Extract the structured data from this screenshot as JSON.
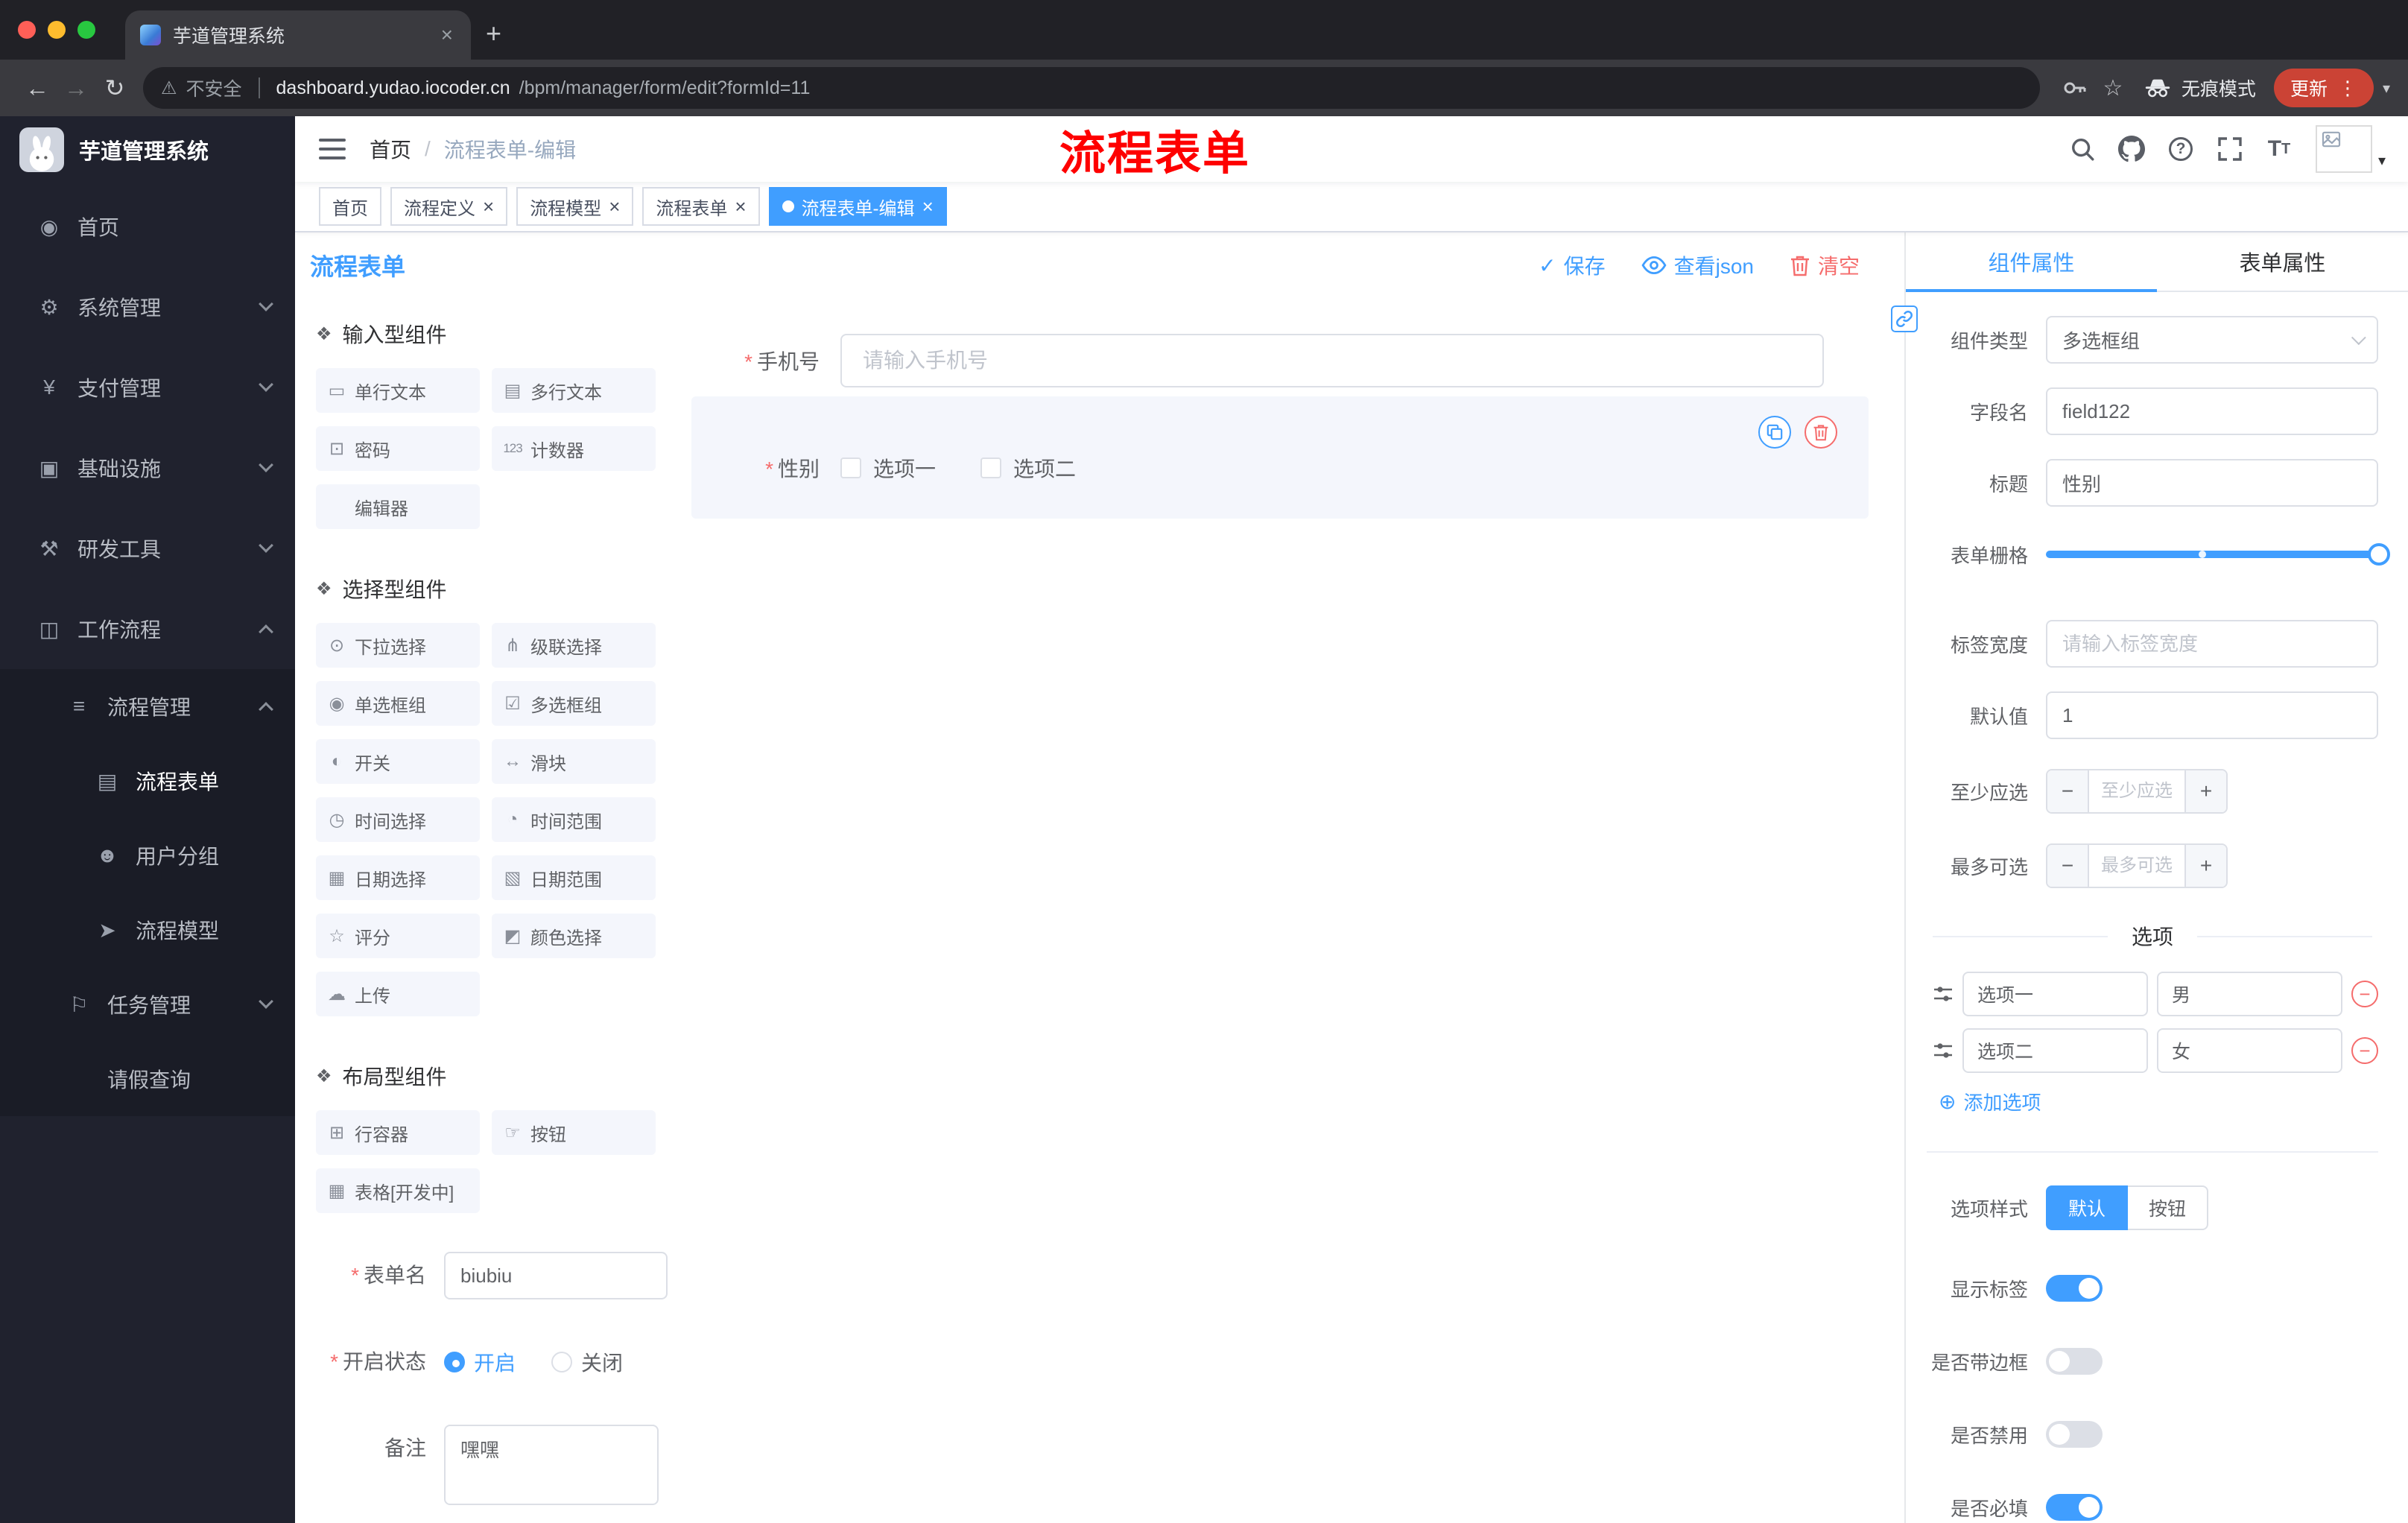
{
  "colors": {
    "primary": "#409eff",
    "danger": "#f56c6c",
    "annotation_red": "#fe0000",
    "update_button_bg": "#cb4335",
    "sidebar_bg": "#20222e",
    "active_tag_bg": "#409eff"
  },
  "icons": {
    "back": "←",
    "forward": "→",
    "reload": "↻",
    "warning": "⚠",
    "star": "☆",
    "dots": "⋮",
    "caret": "▾",
    "close": "×",
    "plus": "+",
    "check": "✓",
    "plus_circle": "⊕",
    "minus": "−",
    "section_marker": "❖",
    "question": "?",
    "font_size_big": "T",
    "font_size_small": "T"
  },
  "browser": {
    "tab": {
      "title": "芋道管理系统"
    },
    "toolbar": {
      "security_label": "不安全",
      "url_domain": "dashboard.yudao.iocoder.cn",
      "url_path": "/bpm/manager/form/edit?formId=11",
      "incognito_label": "无痕模式",
      "update_label": "更新"
    }
  },
  "sidebar": {
    "logo_title": "芋道管理系统",
    "items": [
      {
        "label": "首页",
        "icon": "◉"
      },
      {
        "label": "系统管理",
        "icon": "⚙"
      },
      {
        "label": "支付管理",
        "icon": "¥"
      },
      {
        "label": "基础设施",
        "icon": "▣"
      },
      {
        "label": "研发工具",
        "icon": "⚒"
      },
      {
        "label": "工作流程",
        "icon": "◫"
      },
      {
        "label": "流程管理",
        "icon": "≡"
      },
      {
        "label": "流程表单",
        "icon": "▤"
      },
      {
        "label": "用户分组",
        "icon": "☻"
      },
      {
        "label": "流程模型",
        "icon": "➤"
      },
      {
        "label": "任务管理",
        "icon": "⚐"
      },
      {
        "label": "请假查询",
        "icon": "♟"
      }
    ]
  },
  "navbar": {
    "breadcrumb": {
      "home": "首页",
      "separator": "/",
      "current": "流程表单-编辑"
    },
    "annotation": "流程表单"
  },
  "tags": [
    {
      "label": "首页"
    },
    {
      "label": "流程定义"
    },
    {
      "label": "流程模型"
    },
    {
      "label": "流程表单"
    },
    {
      "label": "流程表单-编辑"
    }
  ],
  "designer": {
    "title": "流程表单",
    "required_mark": "*",
    "actions": {
      "save": "保存",
      "view_json": "查看json",
      "clear": "清空"
    },
    "palette": {
      "sections": [
        {
          "title": "输入型组件",
          "items": [
            {
              "label": "单行文本",
              "icon": "▭"
            },
            {
              "label": "多行文本",
              "icon": "▤"
            },
            {
              "label": "密码",
              "icon": "⊡"
            },
            {
              "label": "计数器",
              "icon": "123"
            },
            {
              "label": "编辑器",
              "icon": ""
            }
          ]
        },
        {
          "title": "选择型组件",
          "items": [
            {
              "label": "下拉选择",
              "icon": "⊙"
            },
            {
              "label": "级联选择",
              "icon": "⋔"
            },
            {
              "label": "单选框组",
              "icon": "◉"
            },
            {
              "label": "多选框组",
              "icon": "☑"
            },
            {
              "label": "开关",
              "icon": "◐"
            },
            {
              "label": "滑块",
              "icon": "↔"
            },
            {
              "label": "时间选择",
              "icon": "◷"
            },
            {
              "label": "时间范围",
              "icon": "◔"
            },
            {
              "label": "日期选择",
              "icon": "▦"
            },
            {
              "label": "日期范围",
              "icon": "▧"
            },
            {
              "label": "评分",
              "icon": "☆"
            },
            {
              "label": "颜色选择",
              "icon": "◩"
            },
            {
              "label": "上传",
              "icon": "☁"
            }
          ]
        },
        {
          "title": "布局型组件",
          "items": [
            {
              "label": "行容器",
              "icon": "⊞"
            },
            {
              "label": "按钮",
              "icon": "☞"
            },
            {
              "label": "表格[开发中]",
              "icon": "▦"
            }
          ]
        }
      ]
    },
    "meta": {
      "name_label": "表单名",
      "name_value": "biubiu",
      "status_label": "开启状态",
      "status_on": "开启",
      "status_off": "关闭",
      "remark_label": "备注",
      "remark_value": "嘿嘿"
    },
    "canvas": {
      "phone_label": "手机号",
      "phone_placeholder": "请输入手机号",
      "gender_label": "性别",
      "gender_options": [
        {
          "label": "选项一"
        },
        {
          "label": "选项二"
        }
      ]
    }
  },
  "props": {
    "tab_component": "组件属性",
    "tab_form": "表单属性",
    "rows": {
      "type_label": "组件类型",
      "type_value": "多选框组",
      "field_label": "字段名",
      "field_value": "field122",
      "title_label": "标题",
      "title_value": "性别",
      "grid_label": "表单栅格",
      "width_label": "标签宽度",
      "width_placeholder": "请输入标签宽度",
      "default_label": "默认值",
      "default_value": "1",
      "min_label": "至少应选",
      "min_placeholder": "至少应选",
      "max_label": "最多可选",
      "max_placeholder": "最多可选"
    },
    "options_title": "选项",
    "options": [
      {
        "name": "选项一",
        "value": "男"
      },
      {
        "name": "选项二",
        "value": "女"
      }
    ],
    "add_option": "添加选项",
    "style_label": "选项样式",
    "style_options": [
      {
        "label": "默认"
      },
      {
        "label": "按钮"
      }
    ],
    "switches": [
      {
        "label": "显示标签"
      },
      {
        "label": "是否带边框"
      },
      {
        "label": "是否禁用"
      },
      {
        "label": "是否必填"
      }
    ]
  }
}
